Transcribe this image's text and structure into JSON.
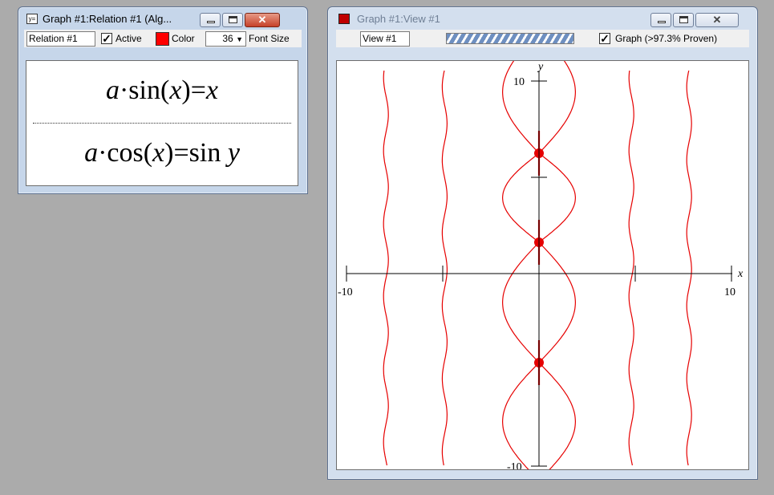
{
  "relation_window": {
    "title": "Graph #1:Relation #1 (Alg...",
    "name_field": "Relation #1",
    "active_label": "Active",
    "active_checked": true,
    "color_label": "Color",
    "color_value": "#ff0000",
    "font_size_value": "36",
    "font_size_label": "Font Size",
    "equation1": {
      "a": "a",
      "dot": "·",
      "func": "sin",
      "lp": "(",
      "x": "x",
      "rp": ")",
      "eq": "=",
      "rhs": "x"
    },
    "equation2": {
      "a": "a",
      "dot": "·",
      "func": "cos",
      "lp": "(",
      "x": "x",
      "rp": ")",
      "eq": "=",
      "rhs_func": "sin",
      "rhs_var": "y"
    }
  },
  "view_window": {
    "title": "Graph #1:View #1",
    "view_field": "View #1",
    "graph_label": "Graph (>97.3% Proven)",
    "graph_checked": true,
    "plot": {
      "x_axis_label": "x",
      "y_axis_label": "y",
      "x_min_label": "-10",
      "x_max_label": "10",
      "y_max_label": "10",
      "y_min_label": "-10",
      "curve_color": "#e60000"
    }
  }
}
